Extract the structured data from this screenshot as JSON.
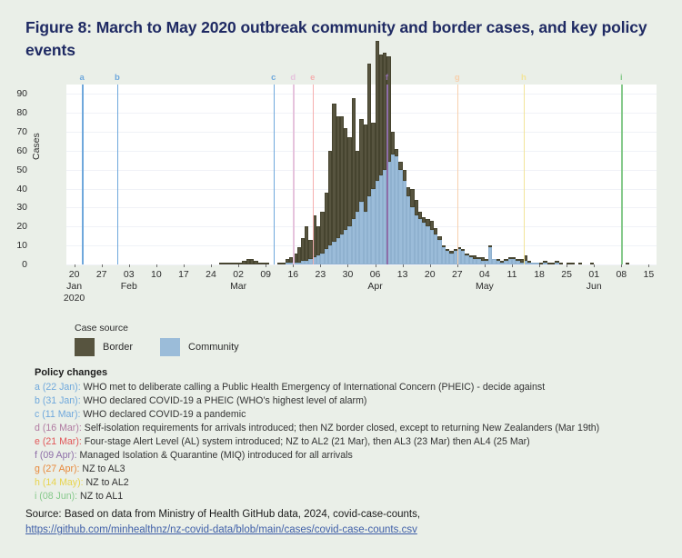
{
  "figure": {
    "title": "Figure 8: March to May 2020 outbreak community and border cases, and key policy events",
    "title_color": "#1f2a63",
    "background": "#eaefe8"
  },
  "legend": {
    "title": "Case source",
    "items": [
      {
        "label": "Border",
        "color": "#57543f"
      },
      {
        "label": "Community",
        "color": "#9bbcd9"
      }
    ]
  },
  "policy": {
    "heading": "Policy changes",
    "items": [
      {
        "key": "a (22 Jan):",
        "color": "#6fa8dc",
        "text": " WHO met to deliberate calling a Public Health Emergency of International Concern (PHEIC) - decide against"
      },
      {
        "key": "b (31 Jan):",
        "color": "#6fa8dc",
        "text": " WHO declared COVID-19 a PHEIC (WHO’s highest level of alarm)"
      },
      {
        "key": "c (11 Mar):",
        "color": "#6fa8dc",
        "text": " WHO declared COVID-19 a pandemic"
      },
      {
        "key": "d (16 Mar):",
        "color": "#b07aa1",
        "text": " Self-isolation requirements for arrivals introduced; then NZ border closed, except to returning New Zealanders (Mar 19th)"
      },
      {
        "key": "e (21 Mar):",
        "color": "#e15759",
        "text": " Four-stage Alert Level (AL) system introduced; NZ to AL2 (21 Mar), then AL3 (23 Mar) then AL4 (25 Mar)"
      },
      {
        "key": "f (09 Apr):",
        "color": "#8e6ea8",
        "text": " Managed Isolation & Quarantine (MIQ) introduced for all arrivals"
      },
      {
        "key": "g (27 Apr):",
        "color": "#e8883a",
        "text": " NZ to AL3"
      },
      {
        "key": "h (14 May):",
        "color": "#e8d44d",
        "text": " NZ to AL2"
      },
      {
        "key": "i (08 Jun):",
        "color": "#86c98b",
        "text": " NZ to AL1"
      }
    ]
  },
  "source": {
    "text": "Source: Based on data from Ministry of Health GitHub data, 2024, covid-case-counts,",
    "url": "https://github.com/minhealthnz/nz-covid-data/blob/main/cases/covid-case-counts.csv"
  },
  "chart_data": {
    "type": "bar",
    "stacked": true,
    "title": "",
    "xlabel": "",
    "ylabel": "Cases",
    "ylim": [
      0,
      95
    ],
    "yticks": [
      0,
      10,
      20,
      30,
      40,
      50,
      60,
      70,
      80,
      90
    ],
    "grid": true,
    "legend_position": "below-left",
    "x_start": "2020-01-18",
    "x_end": "2020-06-17",
    "x_tick_labels": [
      {
        "label": "20",
        "month": "Jan",
        "year": "2020",
        "date": "2020-01-20"
      },
      {
        "label": "27",
        "month": "",
        "year": "",
        "date": "2020-01-27"
      },
      {
        "label": "03",
        "month": "Feb",
        "year": "",
        "date": "2020-02-03"
      },
      {
        "label": "10",
        "month": "",
        "year": "",
        "date": "2020-02-10"
      },
      {
        "label": "17",
        "month": "",
        "year": "",
        "date": "2020-02-17"
      },
      {
        "label": "24",
        "month": "",
        "year": "",
        "date": "2020-02-24"
      },
      {
        "label": "02",
        "month": "Mar",
        "year": "",
        "date": "2020-03-02"
      },
      {
        "label": "09",
        "month": "",
        "year": "",
        "date": "2020-03-09"
      },
      {
        "label": "16",
        "month": "",
        "year": "",
        "date": "2020-03-16"
      },
      {
        "label": "23",
        "month": "",
        "year": "",
        "date": "2020-03-23"
      },
      {
        "label": "30",
        "month": "",
        "year": "",
        "date": "2020-03-30"
      },
      {
        "label": "06",
        "month": "Apr",
        "year": "",
        "date": "2020-04-06"
      },
      {
        "label": "13",
        "month": "",
        "year": "",
        "date": "2020-04-13"
      },
      {
        "label": "20",
        "month": "",
        "year": "",
        "date": "2020-04-20"
      },
      {
        "label": "27",
        "month": "",
        "year": "",
        "date": "2020-04-27"
      },
      {
        "label": "04",
        "month": "May",
        "year": "",
        "date": "2020-05-04"
      },
      {
        "label": "11",
        "month": "",
        "year": "",
        "date": "2020-05-11"
      },
      {
        "label": "18",
        "month": "",
        "year": "",
        "date": "2020-05-18"
      },
      {
        "label": "25",
        "month": "",
        "year": "",
        "date": "2020-05-25"
      },
      {
        "label": "01",
        "month": "Jun",
        "year": "",
        "date": "2020-06-01"
      },
      {
        "label": "08",
        "month": "",
        "year": "",
        "date": "2020-06-08"
      },
      {
        "label": "15",
        "month": "",
        "year": "",
        "date": "2020-06-15"
      }
    ],
    "series": [
      {
        "name": "Community",
        "color": "#9bbcd9"
      },
      {
        "name": "Border",
        "color": "#57543f"
      }
    ],
    "event_lines": [
      {
        "id": "a",
        "date": "2020-01-22",
        "color": "#6fa8dc"
      },
      {
        "id": "b",
        "date": "2020-01-31",
        "color": "#6fa8dc"
      },
      {
        "id": "c",
        "date": "2020-03-11",
        "color": "#6fa8dc"
      },
      {
        "id": "d",
        "date": "2020-03-16",
        "color": "#e6c3dd"
      },
      {
        "id": "e",
        "date": "2020-03-21",
        "color": "#f5b0b0"
      },
      {
        "id": "f",
        "date": "2020-04-09",
        "color": "#8e6ea8"
      },
      {
        "id": "g",
        "date": "2020-04-27",
        "color": "#f7d0ad"
      },
      {
        "id": "h",
        "date": "2020-05-14",
        "color": "#f2e49a"
      },
      {
        "id": "i",
        "date": "2020-06-08",
        "color": "#86c98b"
      }
    ],
    "daily": [
      {
        "date": "2020-02-26",
        "community": 0,
        "border": 1
      },
      {
        "date": "2020-02-27",
        "community": 0,
        "border": 1
      },
      {
        "date": "2020-02-28",
        "community": 0,
        "border": 1
      },
      {
        "date": "2020-02-29",
        "community": 0,
        "border": 1
      },
      {
        "date": "2020-03-01",
        "community": 0,
        "border": 1
      },
      {
        "date": "2020-03-02",
        "community": 0,
        "border": 1
      },
      {
        "date": "2020-03-03",
        "community": 0,
        "border": 2
      },
      {
        "date": "2020-03-04",
        "community": 0,
        "border": 3
      },
      {
        "date": "2020-03-05",
        "community": 0,
        "border": 3
      },
      {
        "date": "2020-03-06",
        "community": 0,
        "border": 2
      },
      {
        "date": "2020-03-07",
        "community": 0,
        "border": 1
      },
      {
        "date": "2020-03-08",
        "community": 0,
        "border": 1
      },
      {
        "date": "2020-03-09",
        "community": 0,
        "border": 1
      },
      {
        "date": "2020-03-10",
        "community": 0,
        "border": 0
      },
      {
        "date": "2020-03-11",
        "community": 0,
        "border": 0
      },
      {
        "date": "2020-03-12",
        "community": 0,
        "border": 1
      },
      {
        "date": "2020-03-13",
        "community": 0,
        "border": 1
      },
      {
        "date": "2020-03-14",
        "community": 1,
        "border": 2
      },
      {
        "date": "2020-03-15",
        "community": 1,
        "border": 3
      },
      {
        "date": "2020-03-16",
        "community": 1,
        "border": 5
      },
      {
        "date": "2020-03-17",
        "community": 1,
        "border": 8
      },
      {
        "date": "2020-03-18",
        "community": 2,
        "border": 12
      },
      {
        "date": "2020-03-19",
        "community": 2,
        "border": 18
      },
      {
        "date": "2020-03-20",
        "community": 3,
        "border": 10
      },
      {
        "date": "2020-03-21",
        "community": 4,
        "border": 22
      },
      {
        "date": "2020-03-22",
        "community": 5,
        "border": 15
      },
      {
        "date": "2020-03-23",
        "community": 6,
        "border": 22
      },
      {
        "date": "2020-03-24",
        "community": 8,
        "border": 30
      },
      {
        "date": "2020-03-25",
        "community": 10,
        "border": 50
      },
      {
        "date": "2020-03-26",
        "community": 12,
        "border": 73
      },
      {
        "date": "2020-03-27",
        "community": 14,
        "border": 64
      },
      {
        "date": "2020-03-28",
        "community": 16,
        "border": 62
      },
      {
        "date": "2020-03-29",
        "community": 18,
        "border": 54
      },
      {
        "date": "2020-03-30",
        "community": 20,
        "border": 47
      },
      {
        "date": "2020-03-31",
        "community": 24,
        "border": 64
      },
      {
        "date": "2020-04-01",
        "community": 28,
        "border": 32
      },
      {
        "date": "2020-04-02",
        "community": 33,
        "border": 44
      },
      {
        "date": "2020-04-03",
        "community": 28,
        "border": 46
      },
      {
        "date": "2020-04-04",
        "community": 36,
        "border": 70
      },
      {
        "date": "2020-04-05",
        "community": 40,
        "border": 35
      },
      {
        "date": "2020-04-06",
        "community": 44,
        "border": 74
      },
      {
        "date": "2020-04-07",
        "community": 47,
        "border": 64
      },
      {
        "date": "2020-04-08",
        "community": 50,
        "border": 62
      },
      {
        "date": "2020-04-09",
        "community": 54,
        "border": 56
      },
      {
        "date": "2020-04-10",
        "community": 58,
        "border": 12
      },
      {
        "date": "2020-04-11",
        "community": 57,
        "border": 4
      },
      {
        "date": "2020-04-12",
        "community": 50,
        "border": 4
      },
      {
        "date": "2020-04-13",
        "community": 44,
        "border": 6
      },
      {
        "date": "2020-04-14",
        "community": 36,
        "border": 5
      },
      {
        "date": "2020-04-15",
        "community": 30,
        "border": 10
      },
      {
        "date": "2020-04-16",
        "community": 26,
        "border": 8
      },
      {
        "date": "2020-04-17",
        "community": 24,
        "border": 4
      },
      {
        "date": "2020-04-18",
        "community": 22,
        "border": 3
      },
      {
        "date": "2020-04-19",
        "community": 20,
        "border": 4
      },
      {
        "date": "2020-04-20",
        "community": 18,
        "border": 5
      },
      {
        "date": "2020-04-21",
        "community": 16,
        "border": 3
      },
      {
        "date": "2020-04-22",
        "community": 13,
        "border": 2
      },
      {
        "date": "2020-04-23",
        "community": 9,
        "border": 1
      },
      {
        "date": "2020-04-24",
        "community": 7,
        "border": 1
      },
      {
        "date": "2020-04-25",
        "community": 6,
        "border": 1
      },
      {
        "date": "2020-04-26",
        "community": 7,
        "border": 1
      },
      {
        "date": "2020-04-27",
        "community": 8,
        "border": 1
      },
      {
        "date": "2020-04-28",
        "community": 7,
        "border": 1
      },
      {
        "date": "2020-04-29",
        "community": 5,
        "border": 1
      },
      {
        "date": "2020-04-30",
        "community": 4,
        "border": 1
      },
      {
        "date": "2020-05-01",
        "community": 3,
        "border": 2
      },
      {
        "date": "2020-05-02",
        "community": 3,
        "border": 1
      },
      {
        "date": "2020-05-03",
        "community": 2,
        "border": 2
      },
      {
        "date": "2020-05-04",
        "community": 2,
        "border": 1
      },
      {
        "date": "2020-05-05",
        "community": 9,
        "border": 1
      },
      {
        "date": "2020-05-06",
        "community": 3,
        "border": 0
      },
      {
        "date": "2020-05-07",
        "community": 2,
        "border": 1
      },
      {
        "date": "2020-05-08",
        "community": 1,
        "border": 1
      },
      {
        "date": "2020-05-09",
        "community": 2,
        "border": 1
      },
      {
        "date": "2020-05-10",
        "community": 3,
        "border": 1
      },
      {
        "date": "2020-05-11",
        "community": 3,
        "border": 1
      },
      {
        "date": "2020-05-12",
        "community": 2,
        "border": 1
      },
      {
        "date": "2020-05-13",
        "community": 1,
        "border": 2
      },
      {
        "date": "2020-05-14",
        "community": 2,
        "border": 3
      },
      {
        "date": "2020-05-15",
        "community": 1,
        "border": 1
      },
      {
        "date": "2020-05-16",
        "community": 1,
        "border": 0
      },
      {
        "date": "2020-05-17",
        "community": 1,
        "border": 0
      },
      {
        "date": "2020-05-18",
        "community": 0,
        "border": 1
      },
      {
        "date": "2020-05-19",
        "community": 1,
        "border": 1
      },
      {
        "date": "2020-05-20",
        "community": 0,
        "border": 1
      },
      {
        "date": "2020-05-21",
        "community": 0,
        "border": 1
      },
      {
        "date": "2020-05-22",
        "community": 1,
        "border": 1
      },
      {
        "date": "2020-05-23",
        "community": 0,
        "border": 1
      },
      {
        "date": "2020-05-24",
        "community": 0,
        "border": 0
      },
      {
        "date": "2020-05-25",
        "community": 0,
        "border": 1
      },
      {
        "date": "2020-05-26",
        "community": 0,
        "border": 1
      },
      {
        "date": "2020-05-27",
        "community": 0,
        "border": 0
      },
      {
        "date": "2020-05-28",
        "community": 0,
        "border": 1
      },
      {
        "date": "2020-05-29",
        "community": 0,
        "border": 0
      },
      {
        "date": "2020-05-30",
        "community": 0,
        "border": 0
      },
      {
        "date": "2020-05-31",
        "community": 0,
        "border": 1
      },
      {
        "date": "2020-06-01",
        "community": 0,
        "border": 0
      },
      {
        "date": "2020-06-02",
        "community": 0,
        "border": 0
      },
      {
        "date": "2020-06-03",
        "community": 0,
        "border": 0
      },
      {
        "date": "2020-06-04",
        "community": 0,
        "border": 0
      },
      {
        "date": "2020-06-05",
        "community": 0,
        "border": 0
      },
      {
        "date": "2020-06-06",
        "community": 0,
        "border": 0
      },
      {
        "date": "2020-06-07",
        "community": 0,
        "border": 0
      },
      {
        "date": "2020-06-08",
        "community": 0,
        "border": 0
      },
      {
        "date": "2020-06-09",
        "community": 0,
        "border": 1
      },
      {
        "date": "2020-06-10",
        "community": 0,
        "border": 0
      },
      {
        "date": "2020-06-11",
        "community": 0,
        "border": 0
      },
      {
        "date": "2020-06-12",
        "community": 0,
        "border": 0
      },
      {
        "date": "2020-06-13",
        "community": 0,
        "border": 0
      },
      {
        "date": "2020-06-14",
        "community": 0,
        "border": 0
      },
      {
        "date": "2020-06-15",
        "community": 0,
        "border": 0
      }
    ]
  }
}
